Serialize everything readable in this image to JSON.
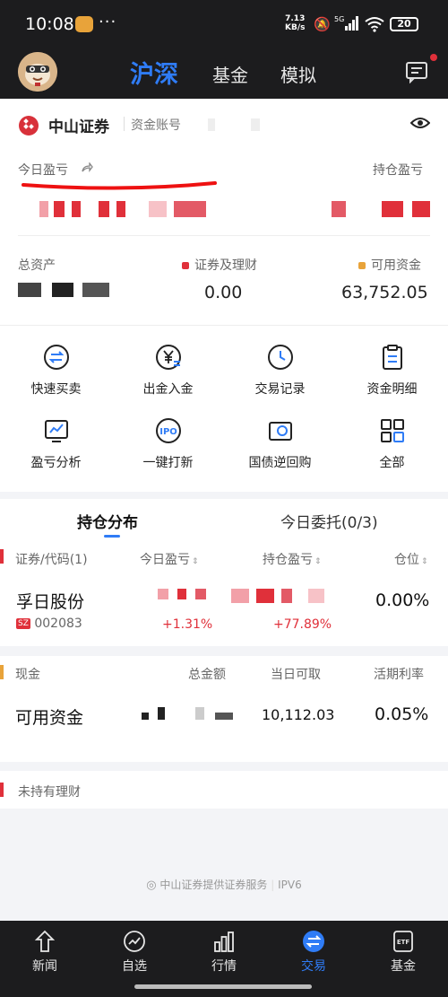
{
  "status": {
    "time": "10:08",
    "dots": "···",
    "speed_top": "7.13",
    "speed_bottom": "KB/s",
    "network": "5G",
    "battery": "20"
  },
  "nav": {
    "tabs": [
      "沪深",
      "基金",
      "模拟"
    ]
  },
  "account": {
    "broker": "中山证券",
    "account_label": "资金账号"
  },
  "pnl": {
    "today_label": "今日盈亏",
    "holding_label": "持仓盈亏"
  },
  "assets": {
    "total_label": "总资产",
    "securities_label": "证券及理财",
    "securities_value": "0.00",
    "available_label": "可用资金",
    "available_value": "63,752.05",
    "colors": {
      "securities": "#e0303a",
      "available": "#e8a33a"
    }
  },
  "shortcuts": [
    {
      "label": "快速买卖",
      "icon": "swap-icon"
    },
    {
      "label": "出金入金",
      "icon": "yen-transfer-icon"
    },
    {
      "label": "交易记录",
      "icon": "clock-icon"
    },
    {
      "label": "资金明细",
      "icon": "clipboard-icon"
    },
    {
      "label": "盈亏分析",
      "icon": "chart-icon"
    },
    {
      "label": "一键打新",
      "icon": "ipo-icon"
    },
    {
      "label": "国债逆回购",
      "icon": "repo-icon"
    },
    {
      "label": "全部",
      "icon": "grid-icon"
    }
  ],
  "positions": {
    "tabs": [
      "持仓分布",
      "今日委托(0/3)"
    ],
    "headers": [
      "证券/代码(1)",
      "今日盈亏",
      "持仓盈亏",
      "仓位"
    ],
    "rows": [
      {
        "name": "孚日股份",
        "market": "SZ",
        "code": "002083",
        "today_pct": "+1.31%",
        "holding_pct": "+77.89%",
        "position": "0.00%"
      }
    ]
  },
  "cash": {
    "headers": [
      "现金",
      "总金额",
      "当日可取",
      "活期利率"
    ],
    "row": {
      "name": "可用资金",
      "withdrawable": "10,112.03",
      "rate": "0.05%"
    }
  },
  "wealth": {
    "label": "未持有理财"
  },
  "footer": {
    "text": "中山证券提供证券服务",
    "ipv6": "IPV6"
  },
  "bottom_nav": [
    {
      "label": "新闻",
      "icon": "news-icon"
    },
    {
      "label": "自选",
      "icon": "watchlist-icon"
    },
    {
      "label": "行情",
      "icon": "market-icon"
    },
    {
      "label": "交易",
      "icon": "trade-icon"
    },
    {
      "label": "基金",
      "icon": "etf-icon"
    }
  ],
  "accent_color": "#2f7cf6"
}
